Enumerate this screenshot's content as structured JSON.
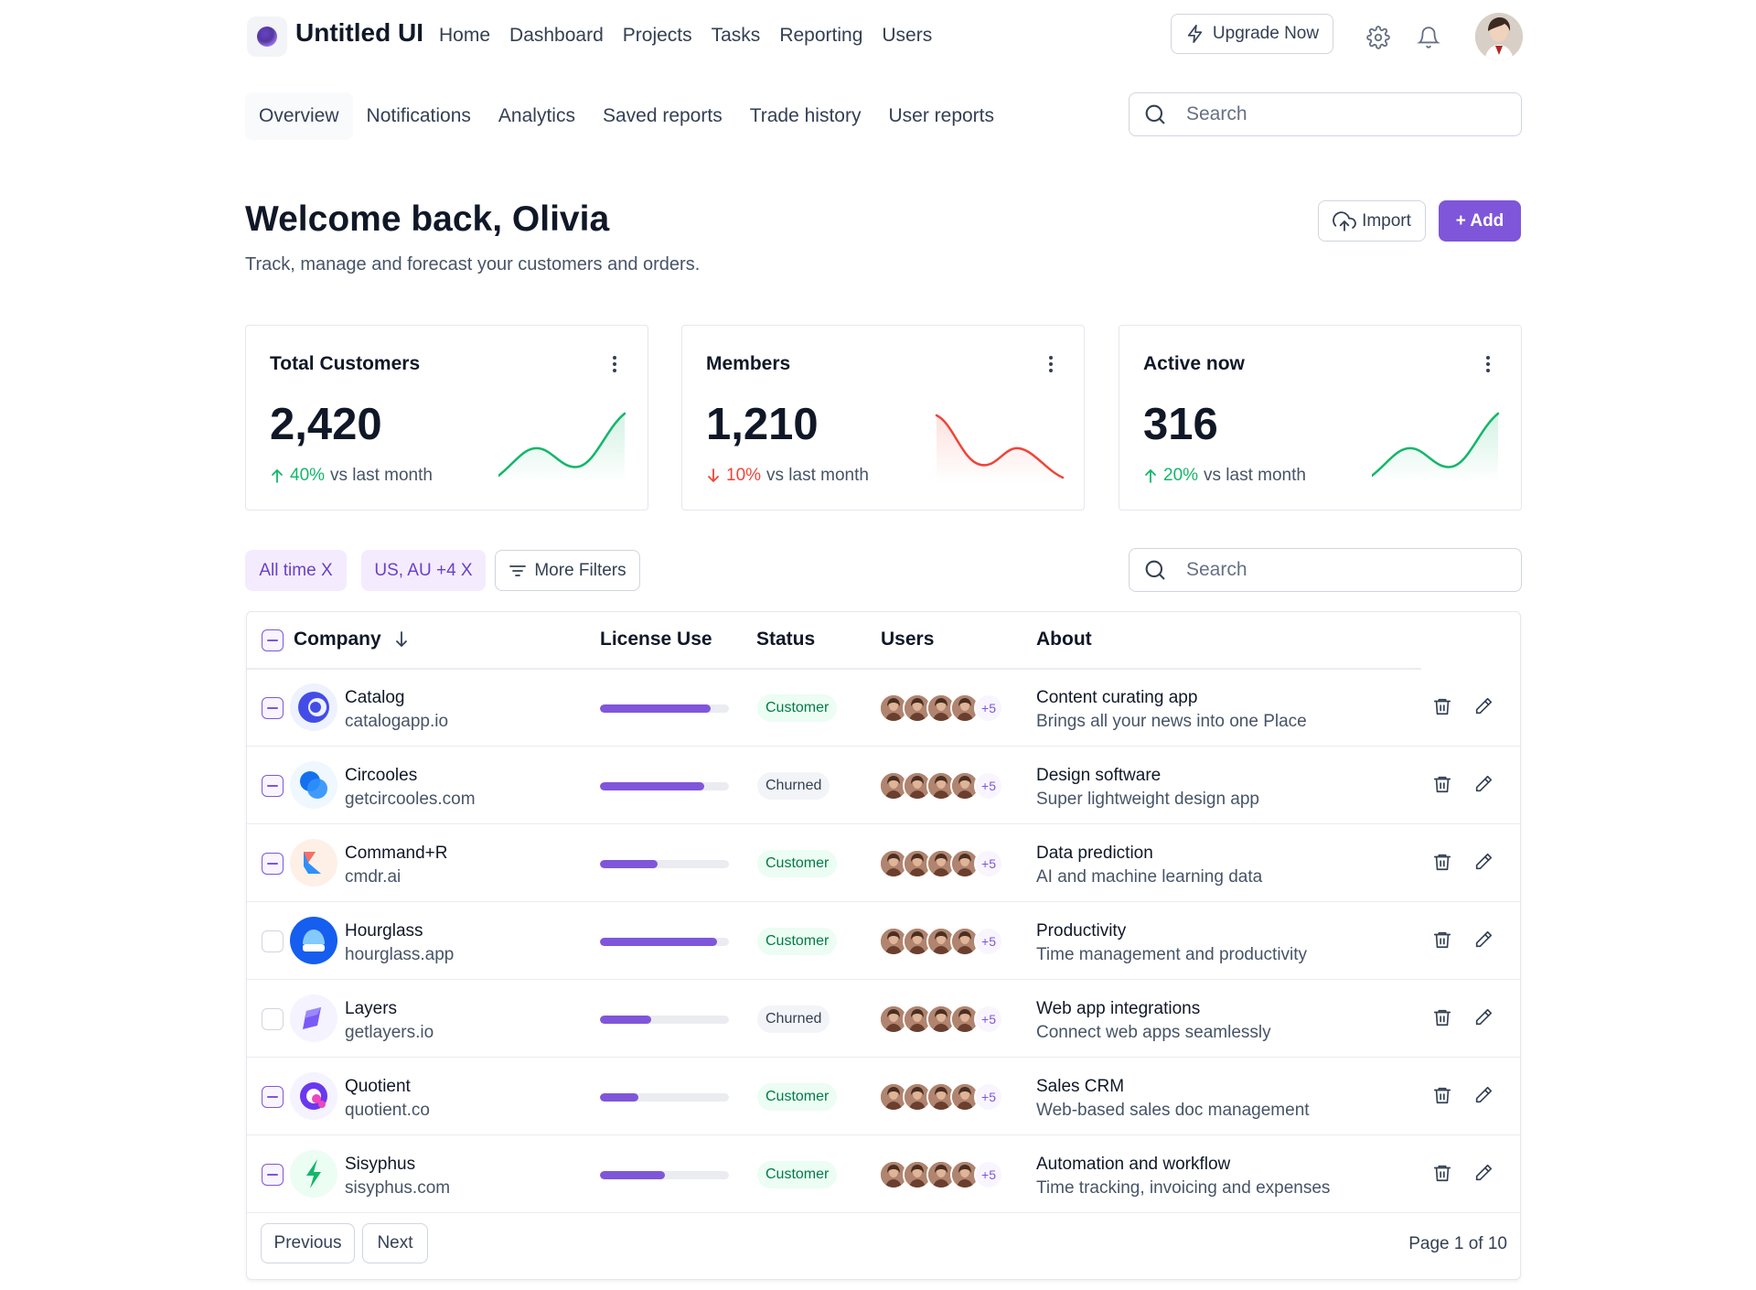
{
  "brand": {
    "name": "Untitled UI"
  },
  "topnav": {
    "items": [
      "Home",
      "Dashboard",
      "Projects",
      "Tasks",
      "Reporting",
      "Users"
    ]
  },
  "header_actions": {
    "upgrade_label": "Upgrade Now"
  },
  "subtabs": {
    "items": [
      "Overview",
      "Notifications",
      "Analytics",
      "Saved reports",
      "Trade history",
      "User reports"
    ],
    "active": "Overview"
  },
  "search_top": {
    "placeholder": "Search"
  },
  "page": {
    "title": "Welcome back, Olivia",
    "subtitle": "Track, manage and forecast your customers and orders.",
    "import_label": "Import",
    "add_label": "+ Add"
  },
  "stats": [
    {
      "title": "Total Customers",
      "value": "2,420",
      "delta": "40%",
      "delta_suffix": "vs last month",
      "trend": "up",
      "color": "#12b76a"
    },
    {
      "title": "Members",
      "value": "1,210",
      "delta": "10%",
      "delta_suffix": "vs last month",
      "trend": "down",
      "color": "#f04438"
    },
    {
      "title": "Active now",
      "value": "316",
      "delta": "20%",
      "delta_suffix": "vs last month",
      "trend": "up",
      "color": "#12b76a"
    }
  ],
  "filters": {
    "chip1": "All time X",
    "chip2": "US, AU +4 X",
    "more_label": "More Filters"
  },
  "search_table": {
    "placeholder": "Search"
  },
  "table": {
    "headers": {
      "company": "Company",
      "license": "License Use",
      "status": "Status",
      "users": "Users",
      "about": "About"
    },
    "rows": [
      {
        "name": "Catalog",
        "domain": "catalogapp.io",
        "license": 0.86,
        "status": "Customer",
        "plus": "+5",
        "about_title": "Content curating app",
        "about_desc": "Brings all your news into one Place",
        "checked": true
      },
      {
        "name": "Circooles",
        "domain": "getcircooles.com",
        "license": 0.81,
        "status": "Churned",
        "plus": "+5",
        "about_title": "Design software",
        "about_desc": "Super lightweight design app",
        "checked": true
      },
      {
        "name": "Command+R",
        "domain": "cmdr.ai",
        "license": 0.45,
        "status": "Customer",
        "plus": "+5",
        "about_title": "Data prediction",
        "about_desc": "AI and machine learning data",
        "checked": true
      },
      {
        "name": "Hourglass",
        "domain": "hourglass.app",
        "license": 0.91,
        "status": "Customer",
        "plus": "+5",
        "about_title": "Productivity",
        "about_desc": "Time management and productivity",
        "checked": false
      },
      {
        "name": "Layers",
        "domain": "getlayers.io",
        "license": 0.4,
        "status": "Churned",
        "plus": "+5",
        "about_title": "Web app integrations",
        "about_desc": "Connect web apps seamlessly",
        "checked": false
      },
      {
        "name": "Quotient",
        "domain": "quotient.co",
        "license": 0.3,
        "status": "Customer",
        "plus": "+5",
        "about_title": "Sales CRM",
        "about_desc": "Web-based sales doc management",
        "checked": true
      },
      {
        "name": "Sisyphus",
        "domain": "sisyphus.com",
        "license": 0.5,
        "status": "Customer",
        "plus": "+5",
        "about_title": "Automation and workflow",
        "about_desc": "Time tracking, invoicing and expenses",
        "checked": true
      }
    ]
  },
  "pagination": {
    "previous": "Previous",
    "next": "Next",
    "info": "Page 1 of 10"
  },
  "colors": {
    "accent": "#7f56d9",
    "success": "#12b76a",
    "error": "#f04438"
  }
}
